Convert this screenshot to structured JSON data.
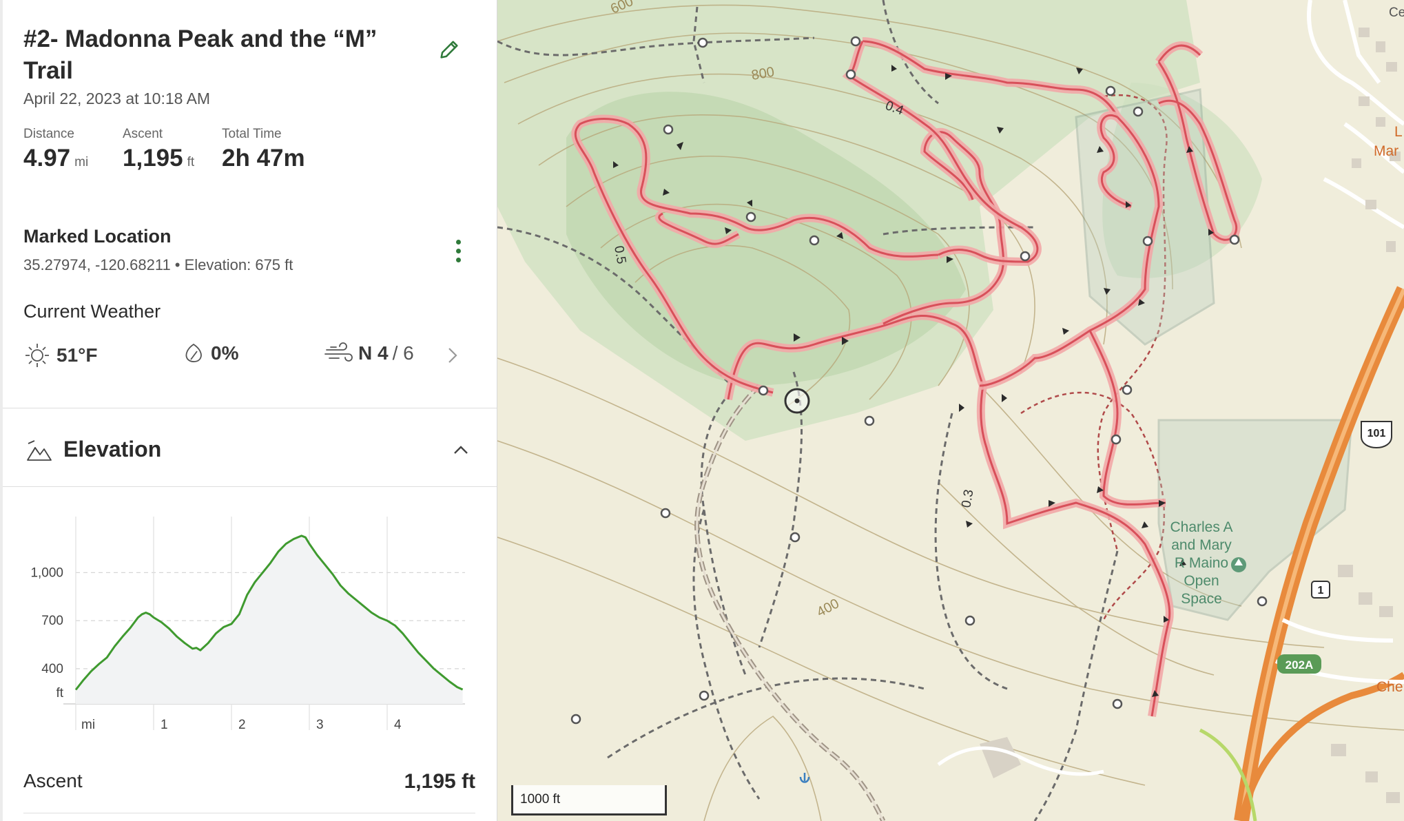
{
  "activity": {
    "title": "#2- Madonna Peak and the “M” Trail",
    "date": "April 22, 2023 at 10:18 AM",
    "edit_icon": "pencil-icon"
  },
  "stats": [
    {
      "label": "Distance",
      "value": "4.97",
      "unit": "mi"
    },
    {
      "label": "Ascent",
      "value": "1,195",
      "unit": "ft"
    },
    {
      "label": "Total Time",
      "value": "2h 47m",
      "unit": ""
    }
  ],
  "marked_location": {
    "title": "Marked Location",
    "coords": "35.27974, -120.68211 • Elevation: 675 ft",
    "menu_icon": "more-vertical-icon"
  },
  "weather": {
    "title": "Current Weather",
    "temp": "51°F",
    "precip": "0%",
    "wind_dir": "N 4",
    "wind_gust": "/ 6",
    "icons": [
      "sun-icon",
      "raindrop-icon",
      "wind-icon",
      "chevron-right-icon"
    ]
  },
  "elevation": {
    "title": "Elevation",
    "icon": "mountain-icon",
    "toggle_icon": "chevron-up-icon",
    "ascent_label": "Ascent",
    "ascent_value": "1,195 ft"
  },
  "chart_data": {
    "type": "line",
    "title": "",
    "xlabel": "mi",
    "ylabel": "ft",
    "x_ticks": [
      "mi",
      "1",
      "2",
      "3",
      "4"
    ],
    "y_ticks": [
      "ft",
      "400",
      "700",
      "1,000"
    ],
    "xlim": [
      0,
      5.0
    ],
    "ylim": [
      180,
      1350
    ],
    "grid": true,
    "color": "#3f9a2f",
    "series": [
      {
        "x": [
          0,
          0.1,
          0.2,
          0.3,
          0.4,
          0.5,
          0.6,
          0.7,
          0.8,
          0.85,
          0.9,
          0.95,
          1.0,
          1.1,
          1.2,
          1.3,
          1.4,
          1.5,
          1.55,
          1.6,
          1.7,
          1.8,
          1.9,
          2.0,
          2.1,
          2.2,
          2.3,
          2.4,
          2.5,
          2.6,
          2.7,
          2.8,
          2.9,
          2.95,
          3.0,
          3.1,
          3.2,
          3.3,
          3.4,
          3.5,
          3.6,
          3.7,
          3.8,
          3.9,
          4.0,
          4.1,
          4.2,
          4.3,
          4.4,
          4.5,
          4.6,
          4.7,
          4.8,
          4.9,
          4.97
        ],
        "y": [
          268,
          330,
          385,
          430,
          470,
          540,
          600,
          655,
          720,
          740,
          750,
          740,
          720,
          690,
          650,
          600,
          560,
          525,
          530,
          515,
          560,
          620,
          660,
          680,
          740,
          860,
          940,
          1000,
          1060,
          1130,
          1180,
          1210,
          1230,
          1220,
          1180,
          1110,
          1050,
          990,
          920,
          870,
          830,
          790,
          750,
          720,
          700,
          670,
          620,
          560,
          500,
          450,
          400,
          360,
          320,
          285,
          270
        ]
      }
    ]
  },
  "map": {
    "scale_label": "1000 ft",
    "contour_labels": [
      "600",
      "800",
      "400"
    ],
    "distance_labels": [
      "0.4",
      "0.5",
      "0.3"
    ],
    "place_labels": [
      "Charles A",
      "and Mary",
      "R Maino",
      "Open",
      "Space"
    ],
    "road_shields": [
      "101",
      "1",
      "202A"
    ],
    "edge_labels": [
      "Ce",
      "L",
      "Mar",
      "Che"
    ]
  }
}
